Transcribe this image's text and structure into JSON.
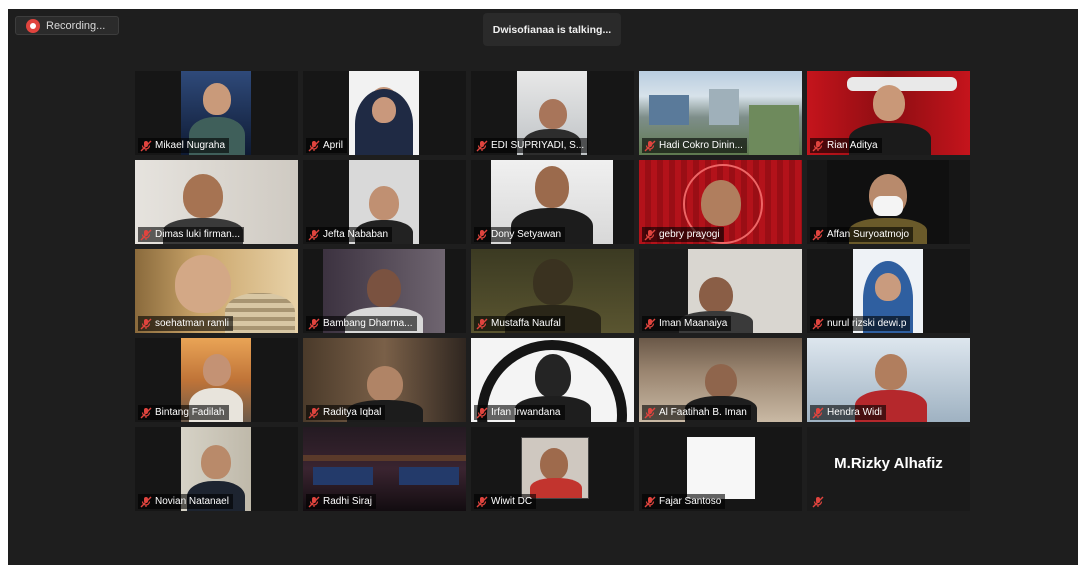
{
  "recording": {
    "label": "Recording..."
  },
  "banner": {
    "talking": "Dwisofianaa is talking..."
  },
  "participants": [
    {
      "name": "Mikael Nugraha"
    },
    {
      "name": "April"
    },
    {
      "name": "EDI SUPRIYADI, S..."
    },
    {
      "name": "Hadi Cokro Dinin..."
    },
    {
      "name": "Rian Aditya"
    },
    {
      "name": "Dimas luki firman..."
    },
    {
      "name": "Jefta Nababan"
    },
    {
      "name": "Dony Setyawan"
    },
    {
      "name": "gebry prayogi"
    },
    {
      "name": "Affan Suryoatmojo"
    },
    {
      "name": "soehatman ramli"
    },
    {
      "name": "Bambang Dharma..."
    },
    {
      "name": "Mustaffa Naufal"
    },
    {
      "name": "Iman Maanaiya"
    },
    {
      "name": "nurul rizski dewi.p"
    },
    {
      "name": "Bintang Fadilah"
    },
    {
      "name": "Raditya Iqbal"
    },
    {
      "name": "Irfan Irwandana"
    },
    {
      "name": "Al Faatihah B. Iman"
    },
    {
      "name": "Hendra Widi"
    },
    {
      "name": "Novian Natanael"
    },
    {
      "name": "Radhi Siraj"
    },
    {
      "name": "Wiwit DC"
    },
    {
      "name": "Fajar Santoso"
    },
    {
      "name": "M.Rizky Alhafiz"
    }
  ],
  "colors": {
    "mute_icon": "#e0443e",
    "background": "#1e1e1e"
  }
}
